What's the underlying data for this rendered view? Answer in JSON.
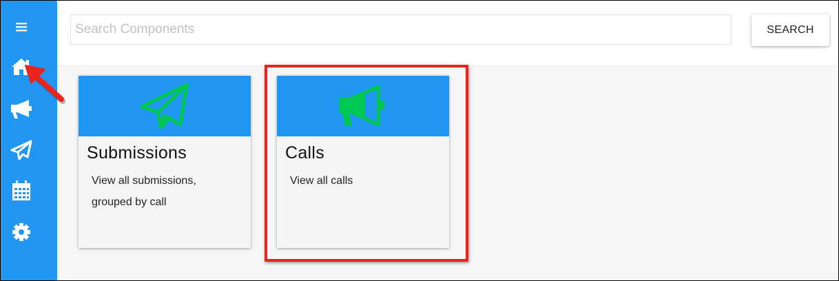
{
  "sidebar": {
    "items": [
      {
        "name": "menu",
        "icon": "menu-icon"
      },
      {
        "name": "home",
        "icon": "home-icon"
      },
      {
        "name": "calls",
        "icon": "megaphone-icon"
      },
      {
        "name": "submissions",
        "icon": "paper-plane-icon"
      },
      {
        "name": "calendar",
        "icon": "calendar-icon"
      },
      {
        "name": "settings",
        "icon": "gear-icon"
      }
    ],
    "color": "#2196f3"
  },
  "search": {
    "placeholder": "Search Components",
    "value": "",
    "button_label": "SEARCH"
  },
  "cards": [
    {
      "title": "Submissions",
      "description": "View all submissions, grouped by call",
      "icon": "paper-plane-icon"
    },
    {
      "title": "Calls",
      "description": "View all calls",
      "icon": "megaphone-icon"
    }
  ],
  "colors": {
    "accent": "#2196f3",
    "card_icon": "#00c853",
    "highlight": "#e8241d"
  }
}
